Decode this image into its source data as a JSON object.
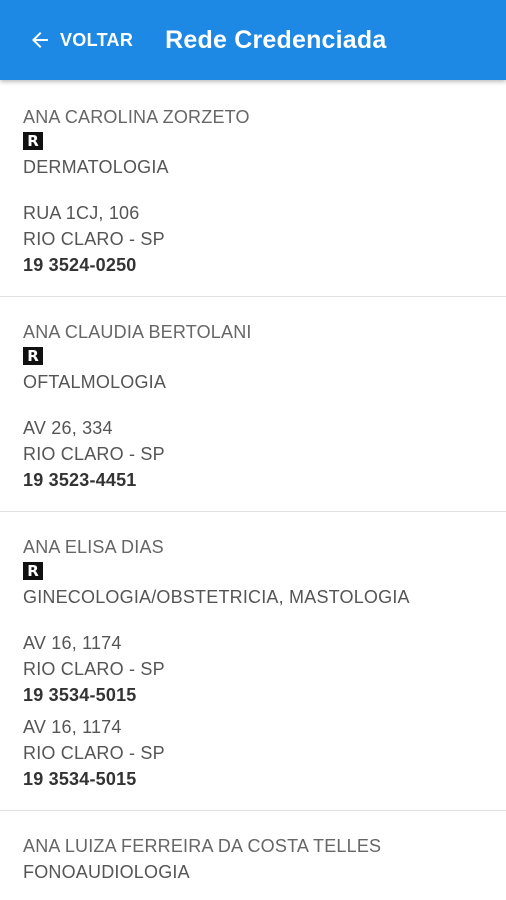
{
  "appbar": {
    "back_label": "VOLTAR",
    "title": "Rede Credenciada",
    "color": "#1e88e5"
  },
  "entries": [
    {
      "name": "ANA CAROLINA ZORZETO",
      "badge": "R",
      "specialty": "DERMATOLOGIA",
      "addresses": [
        {
          "street": "RUA 1CJ, 106",
          "city": "RIO CLARO - SP",
          "phone": "19 3524-0250"
        }
      ]
    },
    {
      "name": "ANA CLAUDIA BERTOLANI",
      "badge": "R",
      "specialty": "OFTALMOLOGIA",
      "addresses": [
        {
          "street": "AV 26, 334",
          "city": "RIO CLARO - SP",
          "phone": "19 3523-4451"
        }
      ]
    },
    {
      "name": "ANA ELISA DIAS",
      "badge": "R",
      "specialty": "GINECOLOGIA/OBSTETRICIA, MASTOLOGIA",
      "addresses": [
        {
          "street": "AV 16, 1174",
          "city": "RIO CLARO - SP",
          "phone": "19 3534-5015"
        },
        {
          "street": "AV 16, 1174",
          "city": "RIO CLARO - SP",
          "phone": "19 3534-5015"
        }
      ]
    },
    {
      "name": "ANA LUIZA FERREIRA DA COSTA TELLES",
      "specialty": "FONOAUDIOLOGIA"
    }
  ]
}
